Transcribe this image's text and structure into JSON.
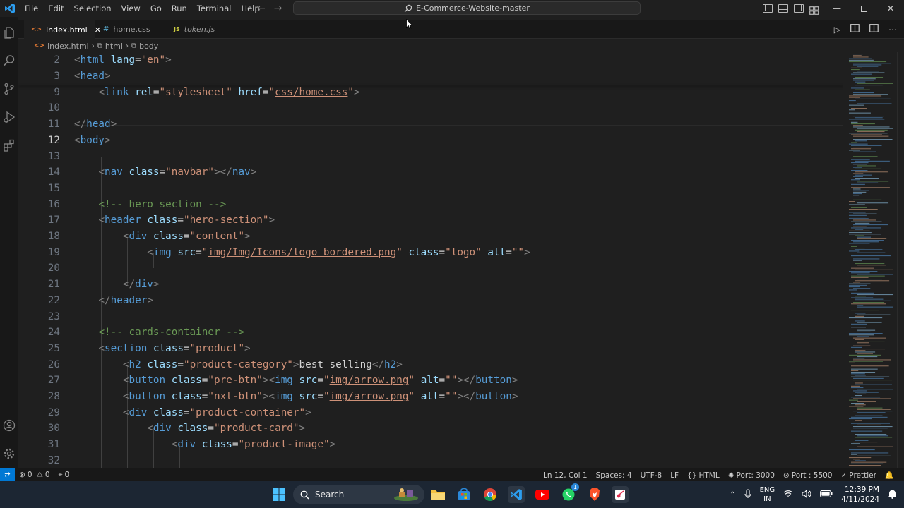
{
  "titlebar": {
    "menu": [
      "File",
      "Edit",
      "Selection",
      "View",
      "Go",
      "Run",
      "Terminal",
      "Help"
    ],
    "command_center": "E-Commerce-Website-master"
  },
  "tabs": [
    {
      "label": "index.html",
      "icon": "html-file-icon",
      "active": true
    },
    {
      "label": "home.css",
      "icon": "css-file-icon",
      "active": false
    },
    {
      "label": "token.js",
      "icon": "js-file-icon",
      "active": false
    }
  ],
  "breadcrumb": [
    "index.html",
    "html",
    "body"
  ],
  "editor": {
    "current_line": 12,
    "lines": [
      {
        "n": "2"
      },
      {
        "n": "3"
      },
      {
        "n": "9"
      },
      {
        "n": "10"
      },
      {
        "n": "11"
      },
      {
        "n": "12"
      },
      {
        "n": "13"
      },
      {
        "n": "14"
      },
      {
        "n": "15"
      },
      {
        "n": "16"
      },
      {
        "n": "17"
      },
      {
        "n": "18"
      },
      {
        "n": "19"
      },
      {
        "n": "20"
      },
      {
        "n": "21"
      },
      {
        "n": "22"
      },
      {
        "n": "23"
      },
      {
        "n": "24"
      },
      {
        "n": "25"
      },
      {
        "n": "26"
      },
      {
        "n": "27"
      },
      {
        "n": "28"
      },
      {
        "n": "29"
      },
      {
        "n": "30"
      },
      {
        "n": "31"
      },
      {
        "n": "32"
      }
    ],
    "code": {
      "l2_tag": "html",
      "l2_attr": "lang",
      "l2_val": "\"en\"",
      "l3_tag": "head",
      "l9_tag": "link",
      "l9_attr1": "rel",
      "l9_val1": "\"stylesheet\"",
      "l9_attr2": "href",
      "l9_val2": "css/home.css",
      "l11_tag": "head",
      "l12_tag": "body",
      "l14_tag": "nav",
      "l14_attr": "class",
      "l14_val": "\"navbar\"",
      "l14_close": "nav",
      "l16_comment": "<!-- hero section -->",
      "l17_tag": "header",
      "l17_attr": "class",
      "l17_val": "\"hero-section\"",
      "l18_tag": "div",
      "l18_attr": "class",
      "l18_val": "\"content\"",
      "l19_tag": "img",
      "l19_attr1": "src",
      "l19_val1": "img/Img/Icons/logo_bordered.png",
      "l19_attr2": "class",
      "l19_val2": "\"logo\"",
      "l19_attr3": "alt",
      "l19_val3": "\"\"",
      "l21_tag": "div",
      "l22_tag": "header",
      "l24_comment": "<!-- cards-container -->",
      "l25_tag": "section",
      "l25_attr": "class",
      "l25_val": "\"product\"",
      "l26_tag": "h2",
      "l26_attr": "class",
      "l26_val": "\"product-category\"",
      "l26_text": "best selling",
      "l27_tag": "button",
      "l27_attr": "class",
      "l27_val": "\"pre-btn\"",
      "l27_img": "img",
      "l27_src": "src",
      "l27_srcval": "img/arrow.png",
      "l27_alt": "alt",
      "l27_altval": "\"\"",
      "l28_tag": "button",
      "l28_attr": "class",
      "l28_val": "\"nxt-btn\"",
      "l28_img": "img",
      "l28_src": "src",
      "l28_srcval": "img/arrow.png",
      "l28_alt": "alt",
      "l28_altval": "\"\"",
      "l29_tag": "div",
      "l29_attr": "class",
      "l29_val": "\"product-container\"",
      "l30_tag": "div",
      "l30_attr": "class",
      "l30_val": "\"product-card\"",
      "l31_tag": "div",
      "l31_attr": "class",
      "l31_val": "\"product-image\""
    }
  },
  "statusbar": {
    "errors": "0",
    "warnings": "0",
    "ports": "0",
    "position": "Ln 12, Col 1",
    "spaces": "Spaces: 4",
    "encoding": "UTF-8",
    "eol": "LF",
    "language": "HTML",
    "port_forward": "Port: 3000",
    "live_server": "Port : 5500",
    "formatter": "Prettier"
  },
  "taskbar": {
    "search_label": "Search",
    "lang_line1": "ENG",
    "lang_line2": "IN",
    "time": "12:39 PM",
    "date": "4/11/2024",
    "whatsapp_badge": "1"
  },
  "colors": {
    "accent": "#0078d4",
    "editor_bg": "#1f1f1f",
    "tag": "#569cd6",
    "attr": "#9cdcfe",
    "string": "#ce9178",
    "comment": "#6a9955"
  }
}
